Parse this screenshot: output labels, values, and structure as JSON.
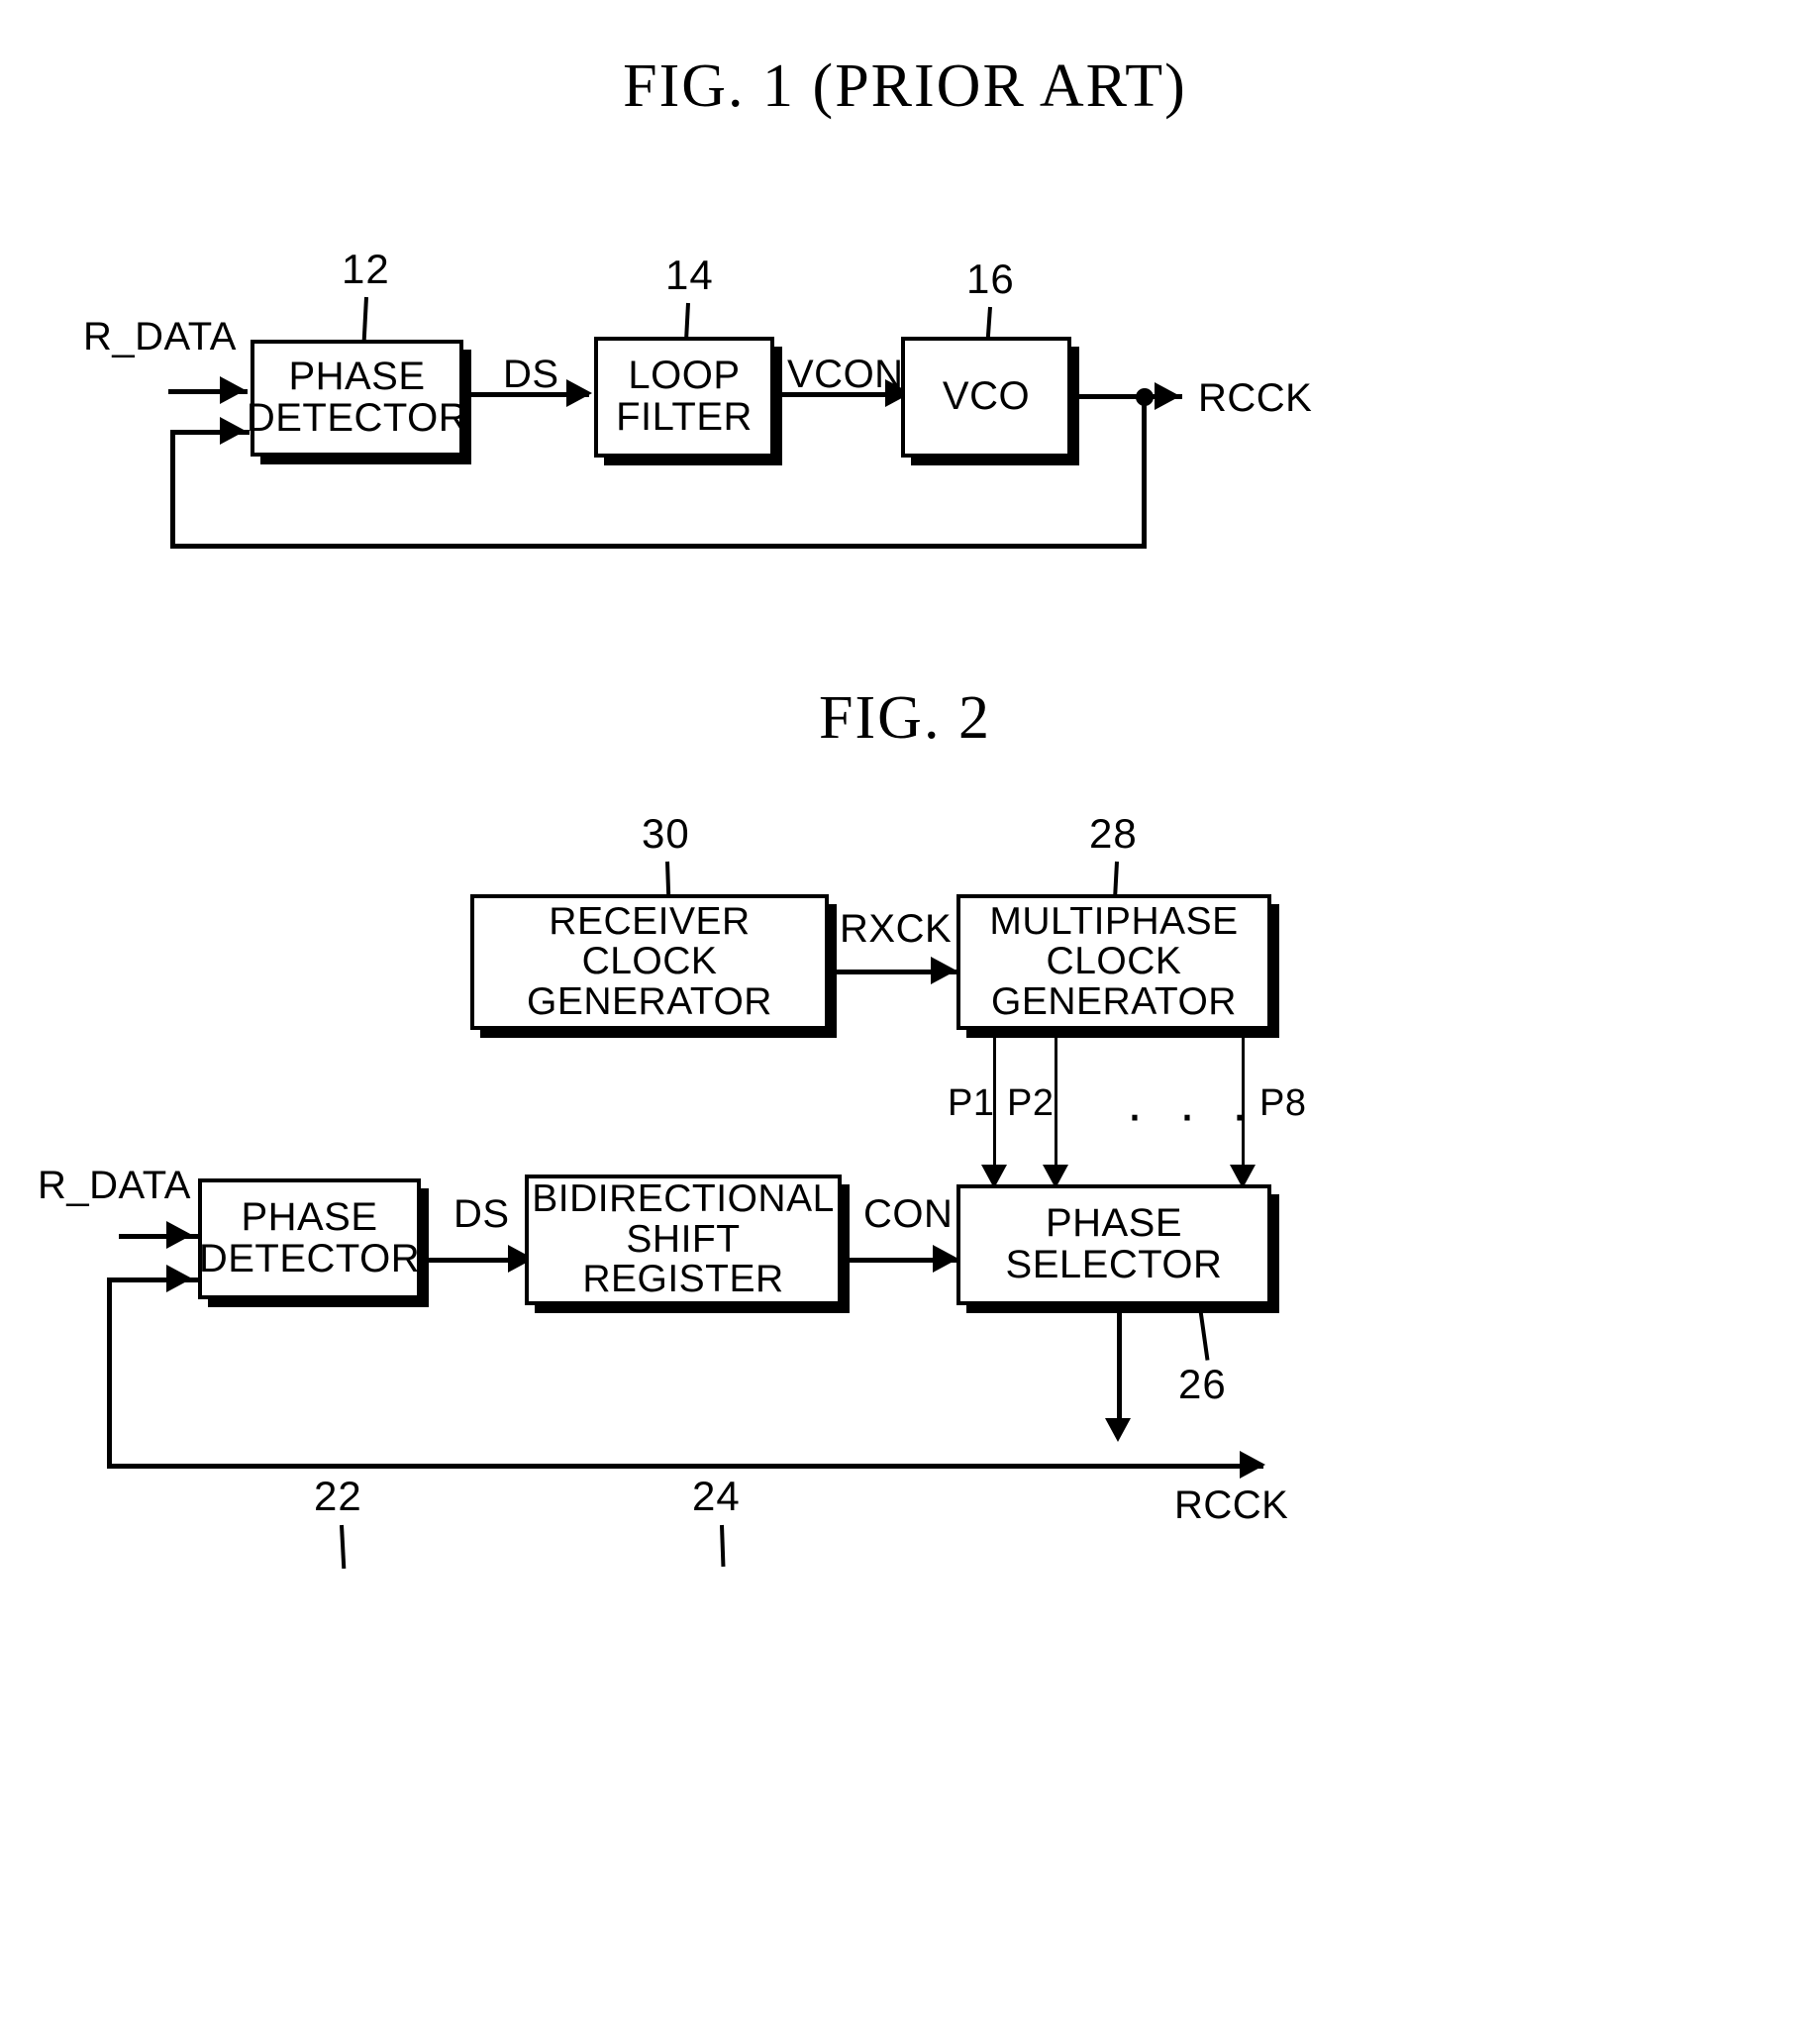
{
  "document": {
    "type": "patent-figure-sheet",
    "background_color": "#ffffff",
    "ink_color": "#000000"
  },
  "figure1": {
    "title": "FIG. 1 (PRIOR ART)",
    "blocks": [
      {
        "ref": "12",
        "label": "PHASE\nDETECTOR"
      },
      {
        "ref": "14",
        "label": "LOOP\nFILTER"
      },
      {
        "ref": "16",
        "label": "VCO"
      }
    ],
    "signals": {
      "input": "R_DATA",
      "pd_to_lf": "DS",
      "lf_to_vco": "VCON",
      "output": "RCCK"
    }
  },
  "figure2": {
    "title": "FIG. 2",
    "blocks": [
      {
        "ref": "30",
        "label": "RECEIVER CLOCK\nGENERATOR"
      },
      {
        "ref": "28",
        "label": "MULTIPHASE\nCLOCK\nGENERATOR"
      },
      {
        "ref": "22",
        "label": "PHASE\nDETECTOR"
      },
      {
        "ref": "24",
        "label": "BIDIRECTIONAL\nSHIFT\nREGISTER"
      },
      {
        "ref": "26",
        "label": "PHASE\nSELECTOR"
      }
    ],
    "signals": {
      "input": "R_DATA",
      "rcg_to_mcg": "RXCK",
      "pd_to_bsr": "DS",
      "bsr_to_ps": "CON",
      "output": "RCCK"
    },
    "phase_taps": {
      "first": "P1",
      "second": "P2",
      "ellipsis": "· · ·",
      "last": "P8"
    }
  }
}
